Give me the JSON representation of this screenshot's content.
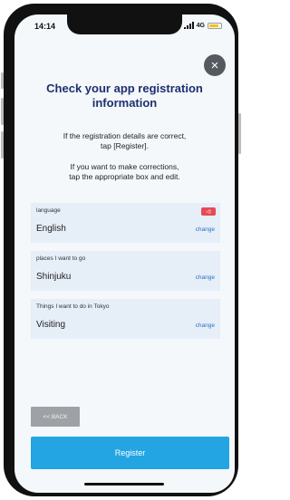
{
  "status_bar": {
    "time": "14:14",
    "network": "4G"
  },
  "header": {
    "close_symbol": "×",
    "title_line1": "Check your app registration",
    "title_line2": "information"
  },
  "instructions": {
    "line1": "If the registration details are correct,",
    "line2": "tap [Register].",
    "line3": "If you want to make corrections,",
    "line4": "tap the appropriate box and edit."
  },
  "fields": [
    {
      "label": "language",
      "value": "English",
      "change": "change",
      "has_voice_icon": true
    },
    {
      "label": "places I want to go",
      "value": "Shinjuku",
      "change": "change"
    },
    {
      "label": "Things I want to do in Tokyo",
      "value": "Visiting",
      "change": "change"
    }
  ],
  "back_label": "<< BACK",
  "register_label": "Register",
  "colors": {
    "accent": "#23a4e3",
    "title": "#1d2f6f",
    "card_bg": "#e6eef8",
    "link": "#2b73b8",
    "voice_badge": "#e64a57"
  }
}
